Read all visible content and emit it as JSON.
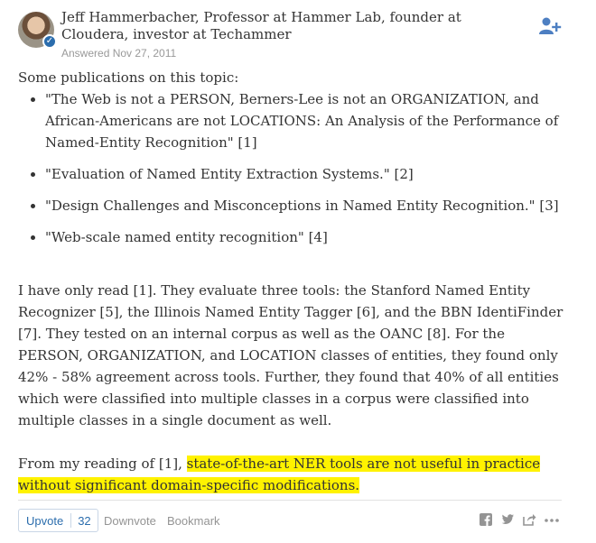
{
  "author": {
    "name_credential": "Jeff Hammerbacher, Professor at Hammer Lab, founder at Cloudera, investor at Techammer",
    "answered": "Answered Nov 27, 2011"
  },
  "answer": {
    "intro": "Some publications on this topic:",
    "publications": [
      {
        "title": "\"The Web is not a PERSON, Berners-Lee is not an ORGANIZATION, and African-Americans are not LOCATIONS: An Analysis of the Performance of Named-Entity Recognition\"",
        "ref": " [1]"
      },
      {
        "title": "\"Evaluation of Named Entity Extraction Systems.\"",
        "ref": " [2]"
      },
      {
        "title": "\"Design Challenges and Misconceptions in Named Entity Recognition.\"",
        "ref": " [3]"
      },
      {
        "title": "\"Web-scale named entity recognition\"",
        "ref": " [4]"
      }
    ],
    "paragraph1": "I have only read [1]. They evaluate three tools: the Stanford Named Entity Recognizer [5], the Illinois Named Entity Tagger [6], and the BBN IdentiFinder [7]. They tested on an internal corpus as well as the OANC [8]. For the PERSON, ORGANIZATION, and LOCATION classes of entities, they found only 42% - 58% agreement across tools. Further, they found that 40% of all entities which were classified into multiple classes in a corpus were classified into multiple classes in a single document as well.",
    "paragraph2_prefix": "From my reading of [1], ",
    "paragraph2_highlight": "state-of-the-art NER tools are not useful in practice without significant domain-specific modifications."
  },
  "actions": {
    "upvote_label": "Upvote",
    "upvote_count": "32",
    "downvote_label": "Downvote",
    "bookmark_label": "Bookmark"
  },
  "colors": {
    "highlight": "#fff200",
    "link_blue": "#2b6dad",
    "muted": "#949494"
  },
  "icons": [
    "verified-badge-icon",
    "follow-user-icon",
    "facebook-icon",
    "twitter-icon",
    "share-icon",
    "more-icon"
  ]
}
